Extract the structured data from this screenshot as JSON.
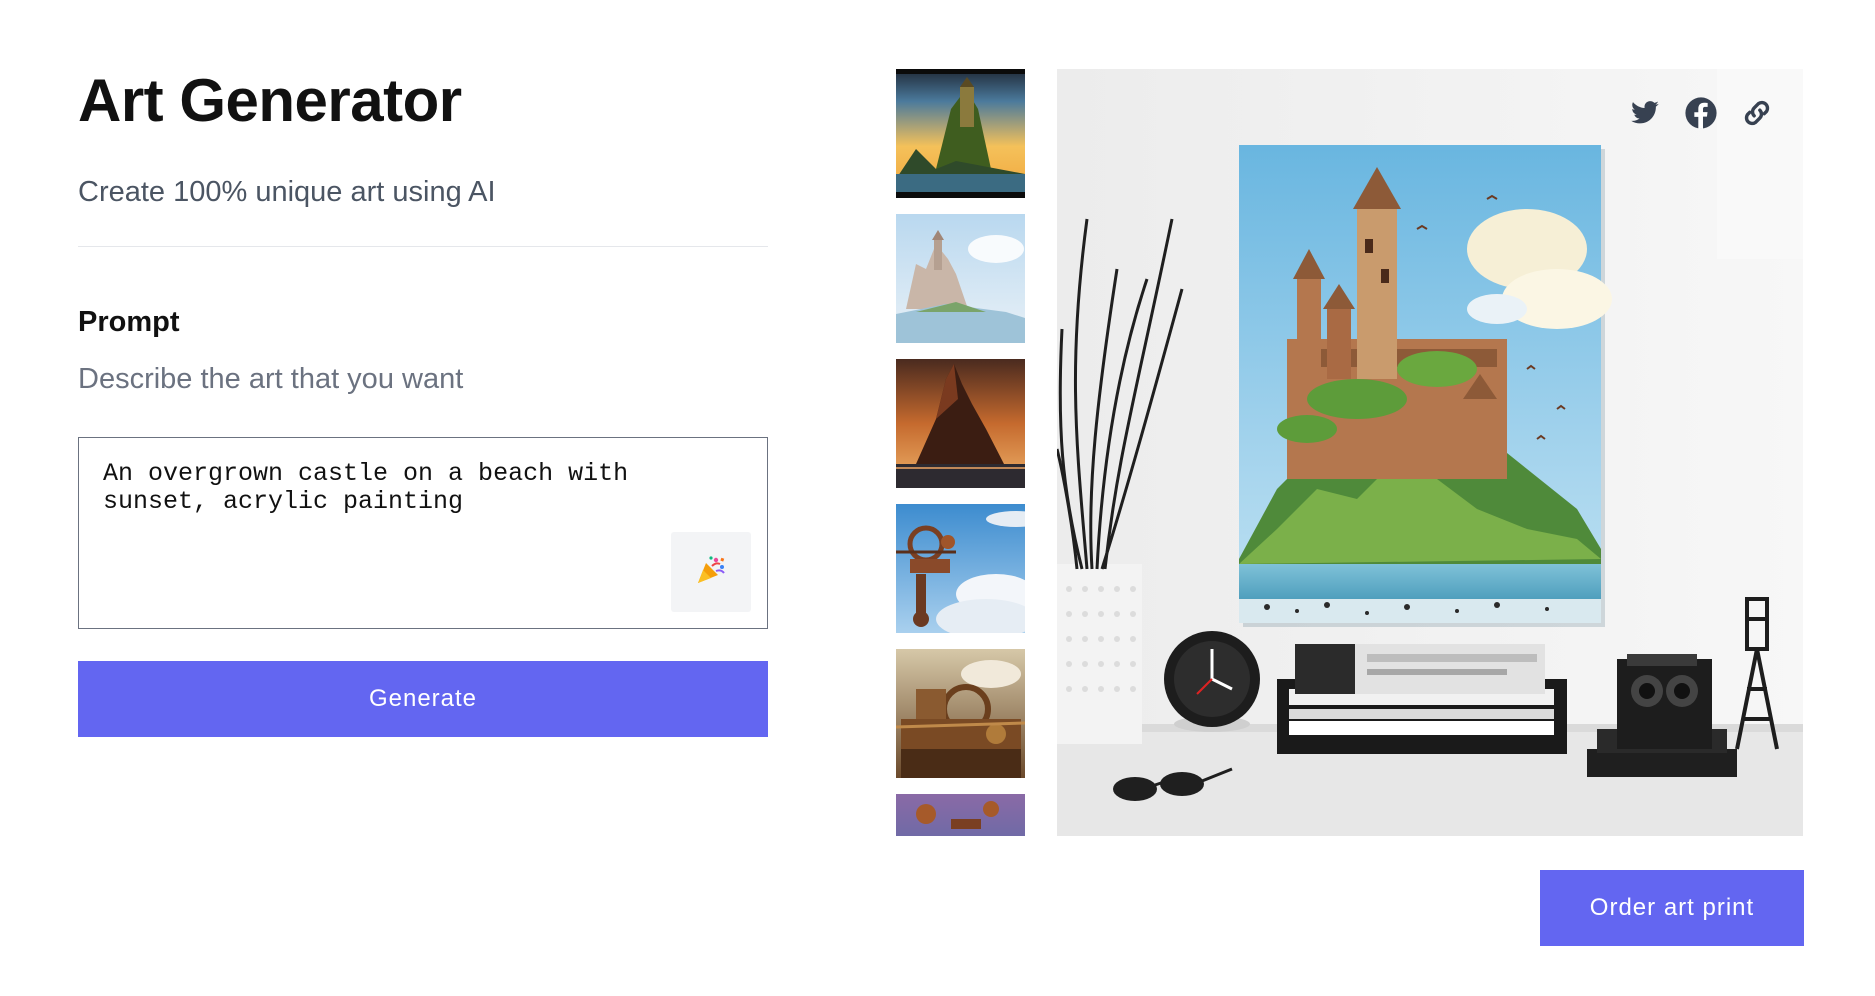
{
  "header": {
    "title": "Art Generator",
    "subtitle": "Create 100% unique art using AI"
  },
  "prompt": {
    "label": "Prompt",
    "help": "Describe the art that you want",
    "value": "An overgrown castle on a beach with sunset, acrylic painting",
    "surprise_icon": "party-popper-icon",
    "surprise_glyph": "🎉"
  },
  "actions": {
    "generate_label": "Generate",
    "order_label": "Order art print"
  },
  "share": {
    "icons": [
      "twitter-icon",
      "facebook-icon",
      "link-icon"
    ]
  },
  "thumbnails": [
    {
      "name": "castle-sunset-thumbnail"
    },
    {
      "name": "castle-misty-thumbnail"
    },
    {
      "name": "rock-castle-sunset-thumbnail"
    },
    {
      "name": "airship-clouds-thumbnail"
    },
    {
      "name": "steampunk-machine-thumbnail"
    },
    {
      "name": "airship-partial-thumbnail"
    }
  ],
  "colors": {
    "accent": "#6366f1",
    "text_primary": "#111111",
    "text_secondary": "#4b5563",
    "text_muted": "#6b7280",
    "divider": "#e5e7eb",
    "icon": "#374151"
  }
}
